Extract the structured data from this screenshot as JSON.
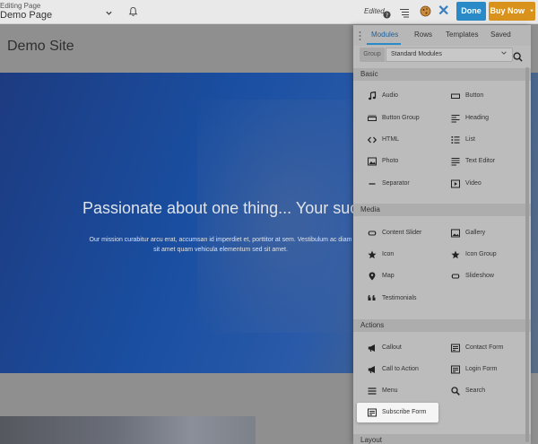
{
  "toolbar": {
    "editing_small": "Editing Page",
    "editing_title": "Demo Page",
    "edited_label": "Edited",
    "done_label": "Done",
    "buy_label": "Buy Now"
  },
  "page": {
    "site_title": "Demo Site",
    "hero_heading": "Passionate about one thing... Your success.",
    "hero_text": "Our mission curabitur arcu erat, accumsan id imperdiet et, porttitor at sem. Vestibulum ac diam sit amet quam vehicula elementum sed sit amet."
  },
  "panel": {
    "tabs": [
      "Modules",
      "Rows",
      "Templates",
      "Saved"
    ],
    "group_label": "Group",
    "group_value": "Standard Modules",
    "sections": {
      "basic": "Basic",
      "media": "Media",
      "actions": "Actions",
      "layout": "Layout"
    },
    "basic": [
      "Audio",
      "Button",
      "Button Group",
      "Heading",
      "HTML",
      "List",
      "Photo",
      "Text Editor",
      "Separator",
      "Video"
    ],
    "media": [
      "Content Slider",
      "Gallery",
      "Icon",
      "Icon Group",
      "Map",
      "Slideshow",
      "Testimonials"
    ],
    "actions": [
      "Callout",
      "Contact Form",
      "Call to Action",
      "Login Form",
      "Menu",
      "Search",
      "Subscribe Form"
    ]
  },
  "colors": {
    "done": "#2a8ac7",
    "buy": "#d9921b",
    "active_tab": "#2a8ac7"
  }
}
